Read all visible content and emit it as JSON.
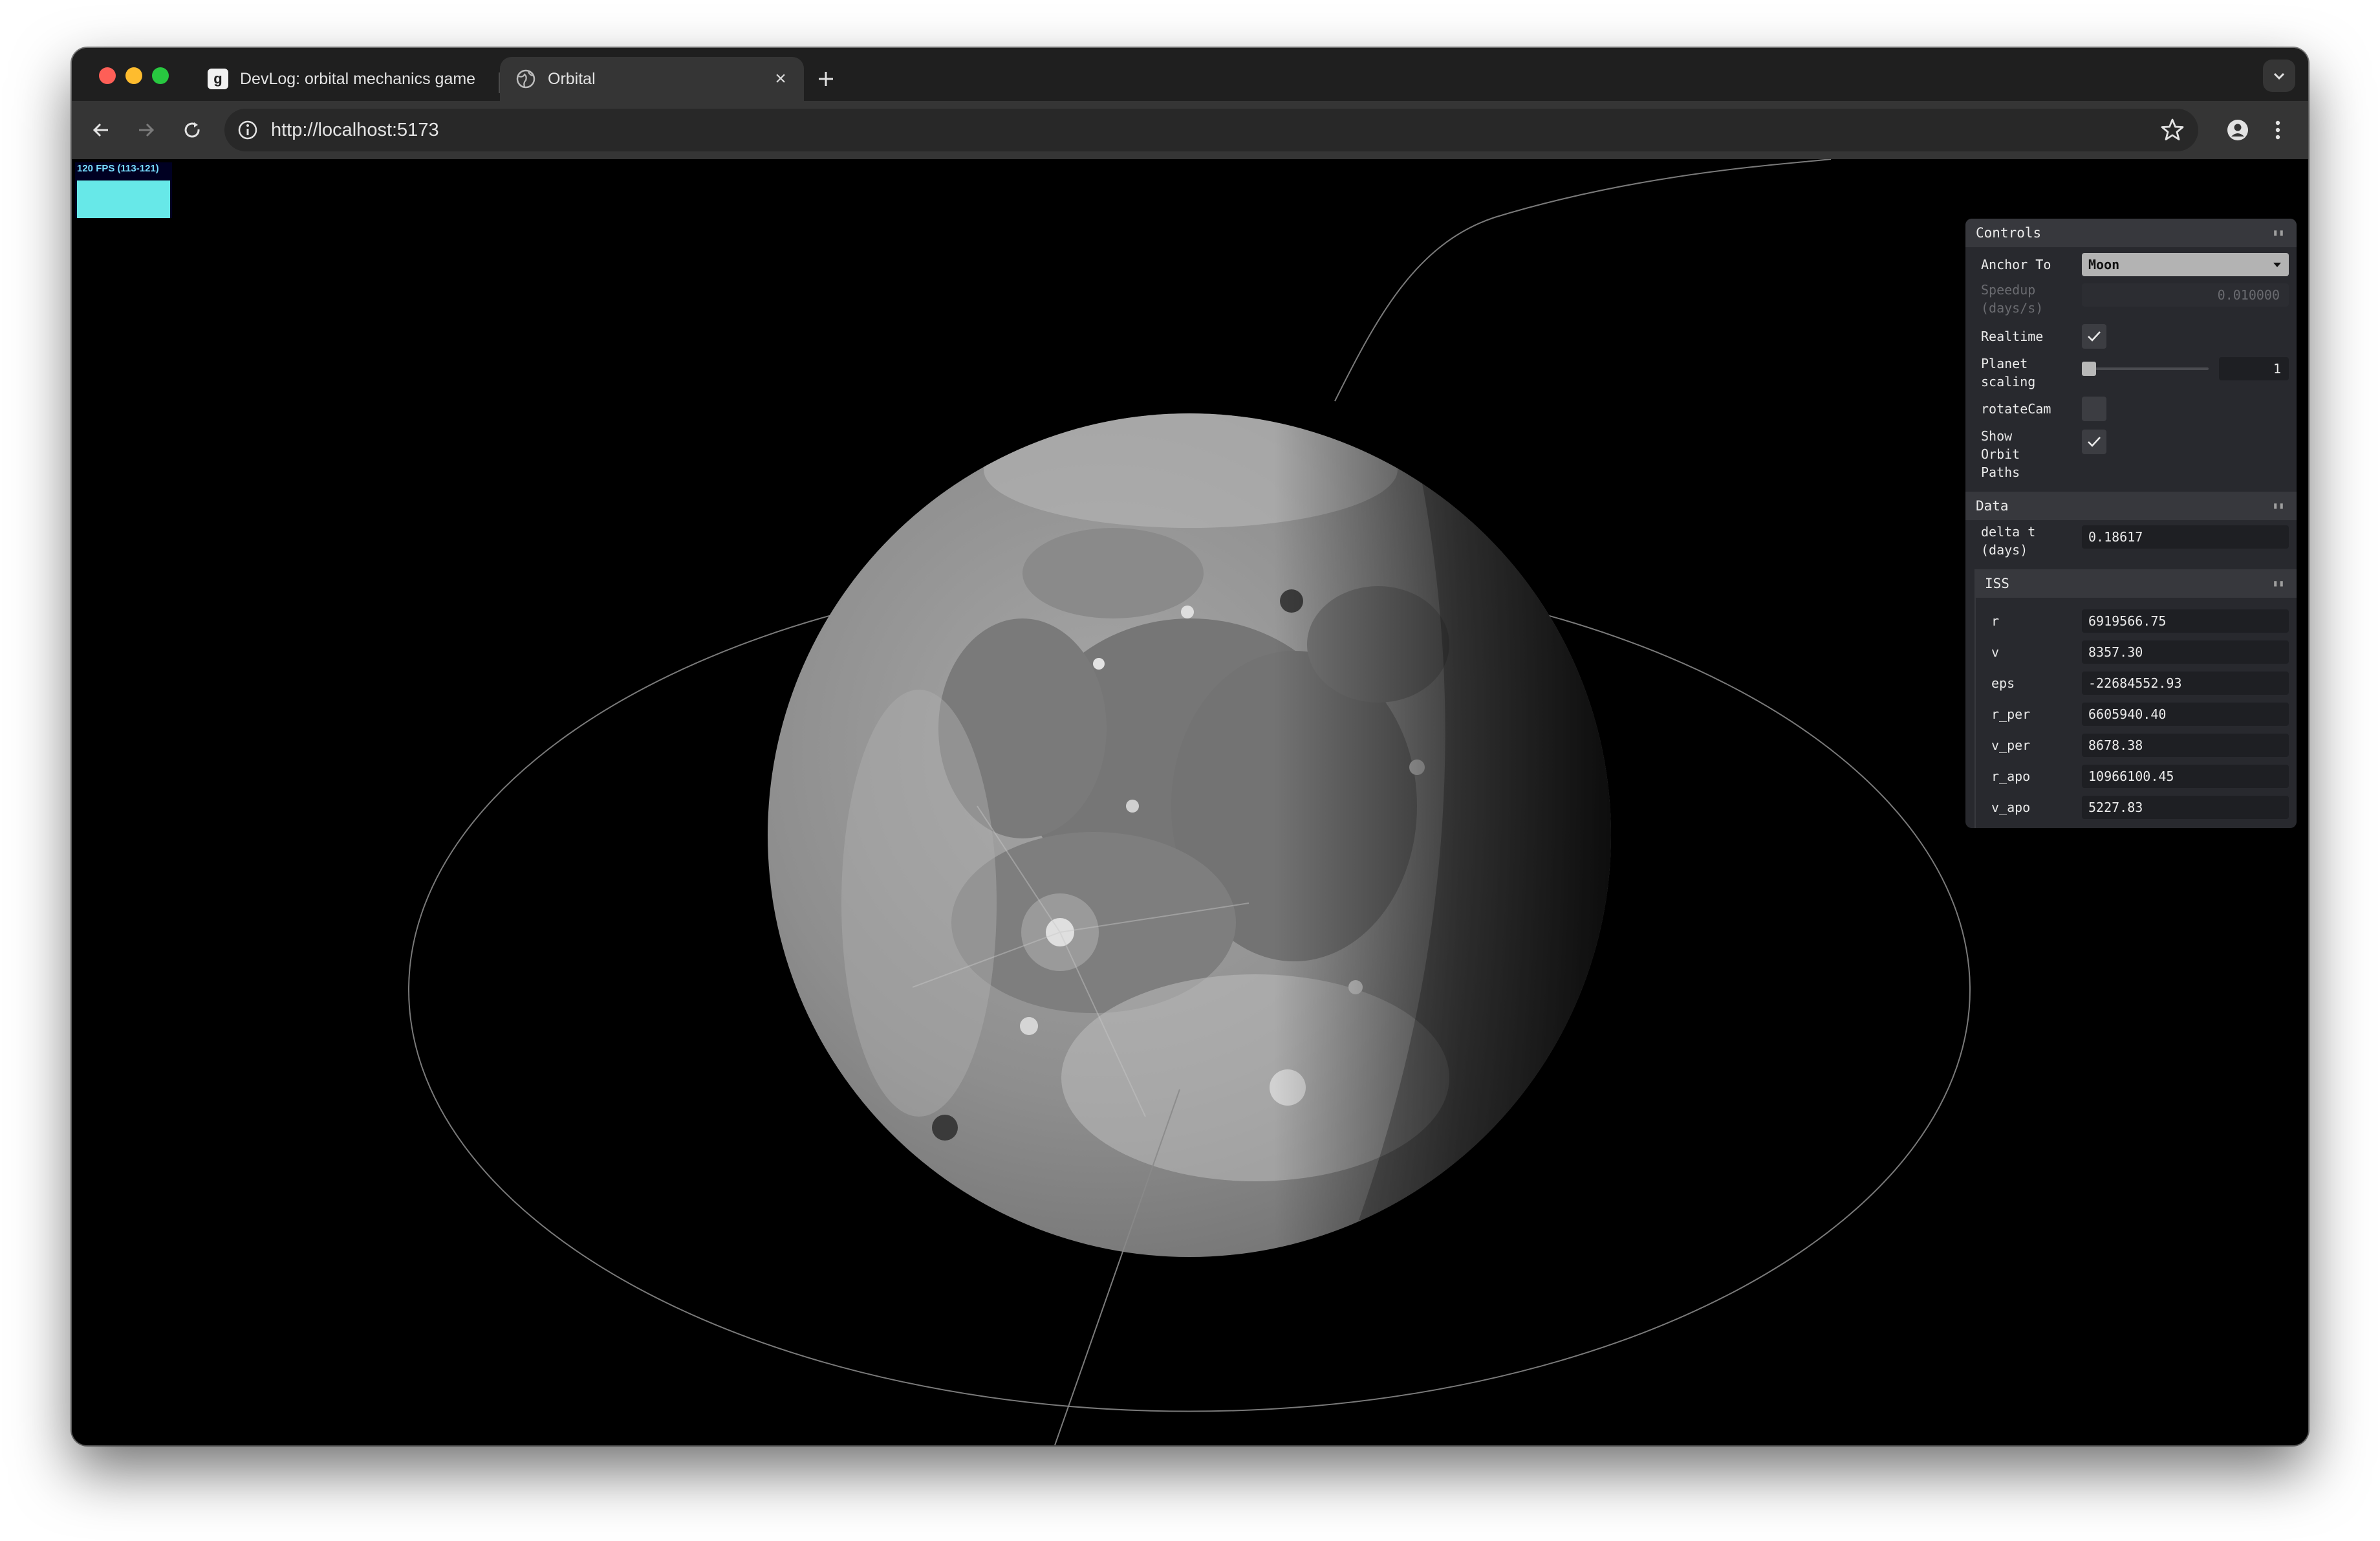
{
  "browser": {
    "tabs": [
      {
        "title": "DevLog: orbital mechanics game",
        "active": false
      },
      {
        "title": "Orbital",
        "active": true
      }
    ],
    "url": "http://localhost:5173",
    "icons": {
      "back": "arrow-left-icon",
      "forward": "arrow-right-icon",
      "reload": "reload-icon",
      "info": "info-icon",
      "bookmark": "star-icon",
      "profile": "person-icon",
      "menu": "kebab-menu-icon",
      "tab_search": "chevron-down-icon",
      "new_tab": "plus-icon",
      "close": "close-icon"
    }
  },
  "stats": {
    "fps_label": "120 FPS (113-121)",
    "graph_color": "#67e8e8"
  },
  "gui": {
    "controls": {
      "title": "Controls",
      "anchor_label": "Anchor To",
      "anchor_value": "Moon",
      "speedup_label_1": "Speedup",
      "speedup_label_2": "(days/s)",
      "speedup_value": "0.010000",
      "realtime_label": "Realtime",
      "realtime_checked": true,
      "planet_label_1": "Planet",
      "planet_label_2": "scaling",
      "planet_value": "1",
      "rotatecam_label": "rotateCam",
      "rotatecam_checked": false,
      "orbit_label_1": "Show",
      "orbit_label_2": "Orbit",
      "orbit_label_3": "Paths",
      "orbit_checked": true
    },
    "data": {
      "title": "Data",
      "delta_label_1": "delta t",
      "delta_label_2": "(days)",
      "delta_value": "0.18617"
    },
    "iss": {
      "title": "ISS",
      "rows": [
        {
          "label": "r",
          "value": "6919566.75"
        },
        {
          "label": "v",
          "value": "8357.30"
        },
        {
          "label": "eps",
          "value": "-22684552.93"
        },
        {
          "label": "r_per",
          "value": "6605940.40"
        },
        {
          "label": "v_per",
          "value": "8678.38"
        },
        {
          "label": "r_apo",
          "value": "10966100.45"
        },
        {
          "label": "v_apo",
          "value": "5227.83"
        }
      ]
    }
  }
}
